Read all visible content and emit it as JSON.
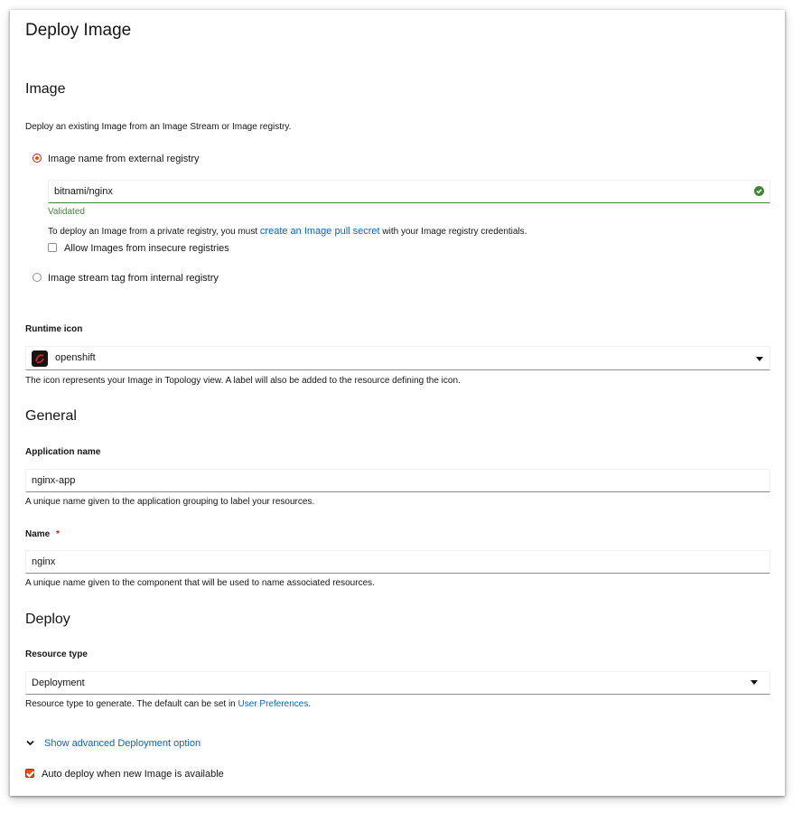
{
  "page": {
    "title": "Deploy Image"
  },
  "image_section": {
    "heading": "Image",
    "description": "Deploy an existing Image from an Image Stream or Image registry.",
    "radio_external_label": "Image name from external registry",
    "image_name_value": "bitnami/nginx",
    "validated_text": "Validated",
    "private_prefix": "To deploy an Image from a private registry, you must",
    "private_link": "create an Image pull secret",
    "private_suffix": "with your Image registry credentials.",
    "insecure_label": "Allow Images from insecure registries",
    "radio_internal_label": "Image stream tag from internal registry"
  },
  "runtime": {
    "label": "Runtime icon",
    "value": "openshift",
    "help": "The icon represents your Image in Topology view. A label will also be added to the resource defining the icon."
  },
  "general": {
    "heading": "General",
    "app_label": "Application name",
    "app_value": "nginx-app",
    "app_help": "A unique name given to the application grouping to label your resources.",
    "name_label": "Name",
    "required_mark": "*",
    "name_value": "nginx",
    "name_help": "A unique name given to the component that will be used to name associated resources."
  },
  "deploy": {
    "heading": "Deploy",
    "resource_label": "Resource type",
    "resource_value": "Deployment",
    "resource_help_prefix": "Resource type to generate. The default can be set in",
    "resource_help_link": "User Preferences",
    "resource_help_suffix": ".",
    "advanced_label": "Show advanced Deployment option",
    "auto_deploy_label": "Auto deploy when new Image is available"
  },
  "colors": {
    "accent": "#e0540e",
    "link": "#0066cc",
    "success": "#3e8635"
  },
  "icons": [
    "check-circle-icon",
    "openshift-icon",
    "caret-down-icon",
    "chevron-down-icon"
  ]
}
